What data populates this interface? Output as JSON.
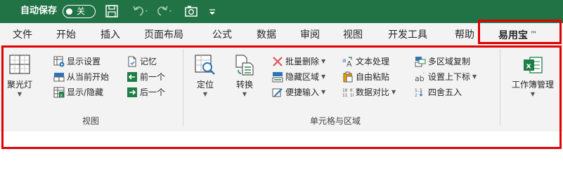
{
  "titlebar": {
    "autosave_label": "自动保存",
    "autosave_state": "关",
    "icons": [
      "save-icon",
      "undo-icon",
      "redo-icon",
      "camera-icon",
      "customize-qat-icon"
    ]
  },
  "tabs": [
    {
      "label": "文件"
    },
    {
      "label": "开始"
    },
    {
      "label": "插入"
    },
    {
      "label": "页面布局"
    },
    {
      "label": "公式"
    },
    {
      "label": "数据"
    },
    {
      "label": "审阅"
    },
    {
      "label": "视图"
    },
    {
      "label": "开发工具"
    },
    {
      "label": "帮助"
    },
    {
      "label": "易用宝",
      "trademark": "™",
      "active": true
    }
  ],
  "ribbon": {
    "view_group": {
      "label": "视图",
      "spotlight": {
        "label": "聚光灯"
      },
      "show_settings": {
        "label": "显示设置"
      },
      "from_current": {
        "label": "从当前开始"
      },
      "show_hide": {
        "label": "显示/隐藏"
      },
      "memory": {
        "label": "记忆"
      },
      "previous": {
        "label": "前一个"
      },
      "next": {
        "label": "后一个"
      }
    },
    "cells_group": {
      "label": "单元格与区域",
      "locate": {
        "label": "定位"
      },
      "convert": {
        "label": "转换"
      },
      "batch_delete": {
        "label": "批量删除"
      },
      "hide_area": {
        "label": "隐藏区域"
      },
      "quick_input": {
        "label": "便捷输入"
      },
      "text_process": {
        "label": "文本处理"
      },
      "free_paste": {
        "label": "自由粘贴"
      },
      "data_compare": {
        "label": "数据对比"
      },
      "multi_copy": {
        "label": "多区域复制"
      },
      "super_sub": {
        "label": "设置上下标"
      },
      "rounding": {
        "label": "四舍五入"
      }
    },
    "workbook_group": {
      "workbook_manage": {
        "label": "工作簿管理"
      }
    }
  },
  "colors": {
    "title_bg": "#217346",
    "ribbon_bg": "#f3f3f3",
    "highlight": "#e00000",
    "accent_green": "#1e7e45",
    "accent_blue": "#2e75b6"
  }
}
